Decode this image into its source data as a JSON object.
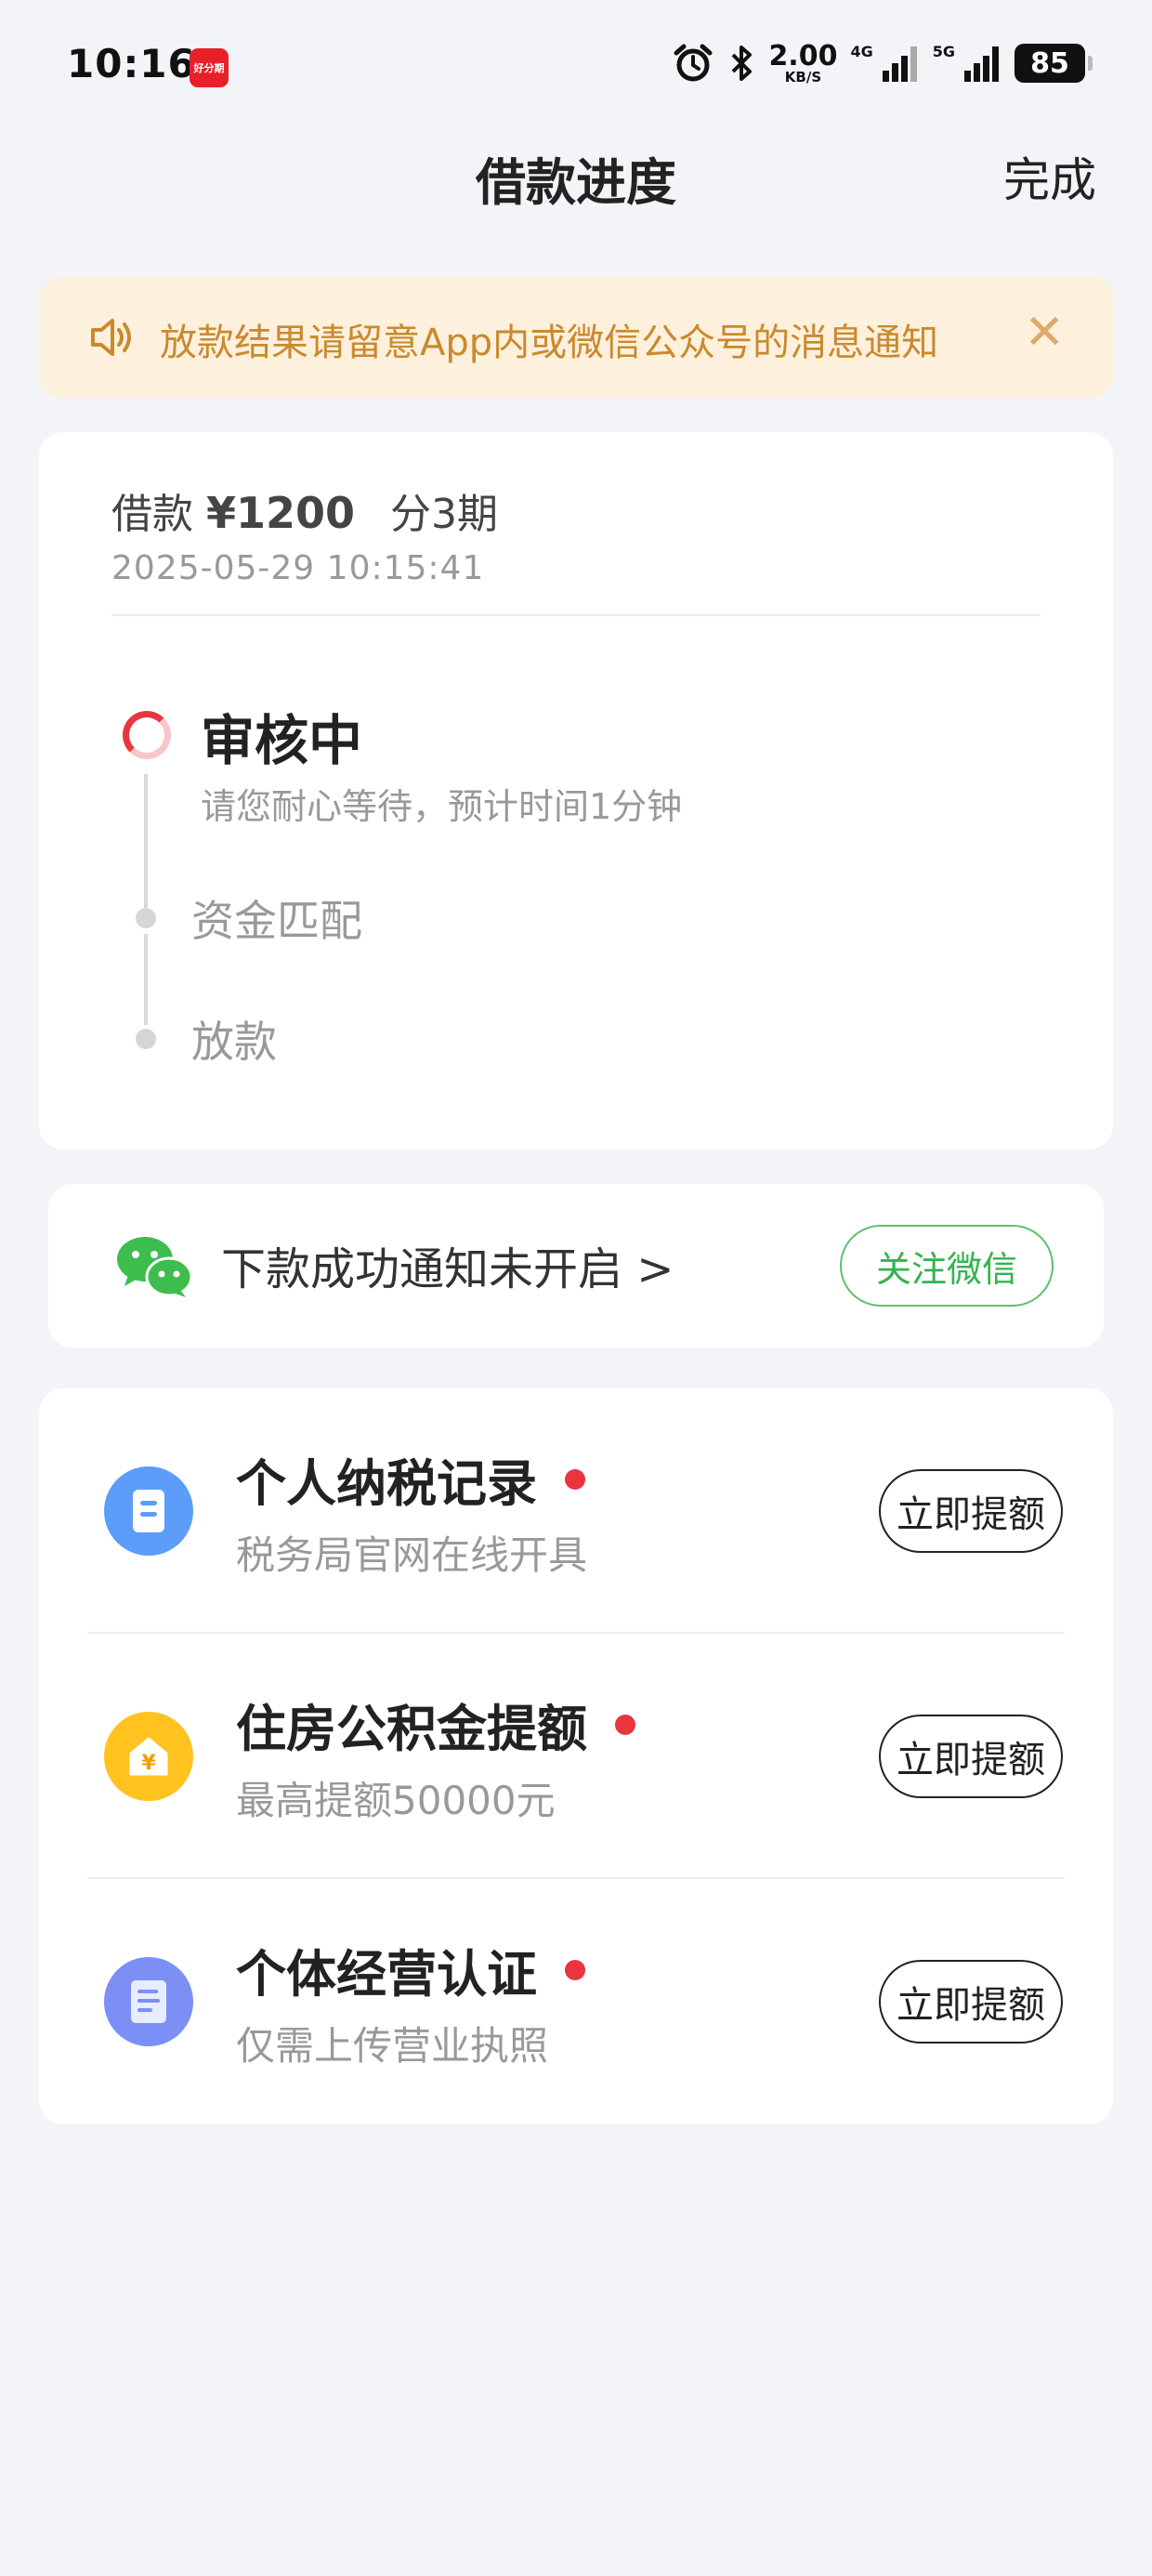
{
  "status_bar": {
    "time": "10:16",
    "app_badge": "好分期",
    "net_speed": "2.00",
    "net_speed_unit": "KB/S",
    "network_1": "4G",
    "network_2": "5G",
    "battery": "85"
  },
  "nav": {
    "title": "借款进度",
    "done_label": "完成"
  },
  "notice": {
    "text": "放款结果请留意App内或微信公众号的消息通知",
    "close_symbol": "✕",
    "color": "#c98a2e"
  },
  "loan": {
    "prefix": "借款",
    "amount": "¥1200",
    "installments": "分3期",
    "datetime": "2025-05-29 10:15:41"
  },
  "timeline": {
    "active_step": {
      "label": "审核中",
      "sub": "请您耐心等待，预计时间1分钟"
    },
    "pending_steps": [
      {
        "label": "资金匹配"
      },
      {
        "label": "放款"
      }
    ],
    "accent_color": "#e8363f"
  },
  "wechat": {
    "text": "下款成功通知未开启 >",
    "button_label": "关注微信",
    "color": "#34b34f"
  },
  "offers": [
    {
      "title": "个人纳税记录",
      "sub": "税务局官网在线开具",
      "button": "立即提额",
      "icon": "document-icon",
      "icon_color": "#5b9df9"
    },
    {
      "title": "住房公积金提额",
      "sub": "最高提额50000元",
      "button": "立即提额",
      "icon": "house-yen-icon",
      "icon_color": "#ffc21f"
    },
    {
      "title": "个体经营认证",
      "sub": "仅需上传营业执照",
      "button": "立即提额",
      "icon": "license-icon",
      "icon_color": "#7b8ff5"
    }
  ]
}
